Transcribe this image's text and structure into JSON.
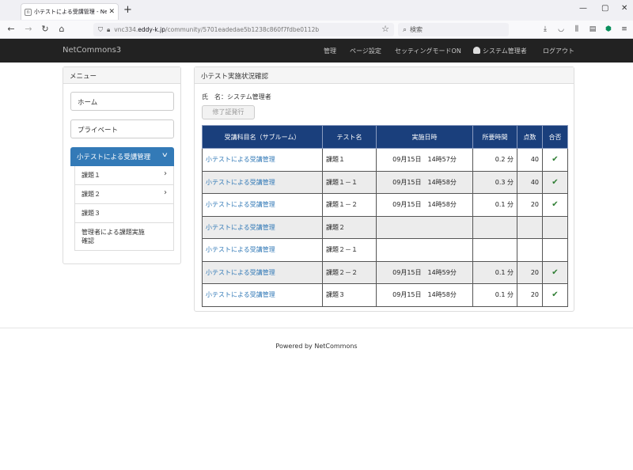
{
  "browser": {
    "tab_title": "小テストによる受講管理 - NetCom",
    "tab_close": "✕",
    "new_tab": "+",
    "url_prefix": "vnc334.",
    "url_domain": "eddy-k.jp",
    "url_path": "/community/5701eadedae5b1238c860f7fdbe0112b",
    "search_placeholder": "検索",
    "window_controls": [
      "—",
      "▢",
      "✕"
    ]
  },
  "site": {
    "brand": "NetCommons3",
    "nav": {
      "manage": "管理",
      "page_settings": "ページ設定",
      "setting_mode": "セッティングモードON",
      "user": "システム管理者",
      "logout": "ログアウト"
    }
  },
  "menu": {
    "title": "メニュー",
    "items": [
      {
        "label": "ホーム"
      },
      {
        "label": "プライベート"
      }
    ],
    "active": {
      "label": "小テストによる受講管理"
    },
    "subitems": [
      {
        "label": "課題１",
        "arrow": "›"
      },
      {
        "label": "課題２",
        "arrow": "›"
      },
      {
        "label": "課題３",
        "arrow": ""
      },
      {
        "label": "管理者による課題実施確認",
        "arrow": ""
      }
    ]
  },
  "main": {
    "title": "小テスト実施状況確認",
    "name_label": "氏　名：",
    "name_value": "システム管理者",
    "cert_button": "修了証発行",
    "table": {
      "headers": [
        "受講科目名（サブルーム）",
        "テスト名",
        "実施日時",
        "所要時間",
        "点数",
        "合否"
      ],
      "rows": [
        {
          "subject": "小テストによる受講管理",
          "test": "課題１",
          "datetime": "09月15日　14時57分",
          "duration": "0.2 分",
          "score": "40",
          "pass": "✔"
        },
        {
          "subject": "小テストによる受講管理",
          "test": "課題１－１",
          "datetime": "09月15日　14時58分",
          "duration": "0.3 分",
          "score": "40",
          "pass": "✔"
        },
        {
          "subject": "小テストによる受講管理",
          "test": "課題１－２",
          "datetime": "09月15日　14時58分",
          "duration": "0.1 分",
          "score": "20",
          "pass": "✔"
        },
        {
          "subject": "小テストによる受講管理",
          "test": "課題２",
          "datetime": "",
          "duration": "",
          "score": "",
          "pass": ""
        },
        {
          "subject": "小テストによる受講管理",
          "test": "課題２－１",
          "datetime": "",
          "duration": "",
          "score": "",
          "pass": ""
        },
        {
          "subject": "小テストによる受講管理",
          "test": "課題２－２",
          "datetime": "09月15日　14時59分",
          "duration": "0.1 分",
          "score": "20",
          "pass": "✔"
        },
        {
          "subject": "小テストによる受講管理",
          "test": "課題３",
          "datetime": "09月15日　14時58分",
          "duration": "0.1 分",
          "score": "20",
          "pass": "✔"
        }
      ]
    }
  },
  "footer": {
    "text": "Powered by NetCommons"
  }
}
